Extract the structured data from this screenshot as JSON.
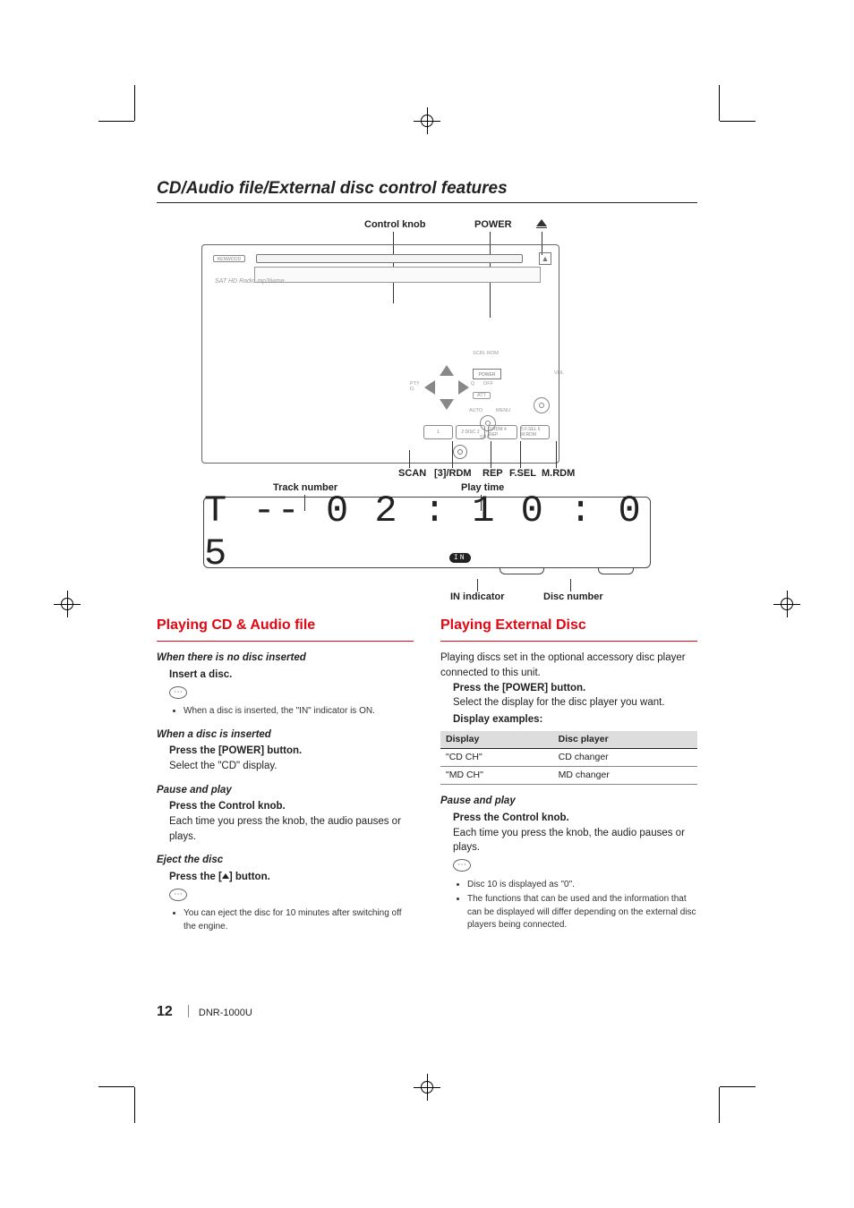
{
  "page_title": "CD/Audio file/External disc control features",
  "diagram_labels": {
    "control_knob": "Control knob",
    "power": "POWER",
    "scan": "SCAN",
    "btn3rdm": "[3]/RDM",
    "rep": "REP",
    "fsel": "F.SEL",
    "mrdm": "M.RDM",
    "track_number": "Track number",
    "play_time": "Play time",
    "in_indicator": "IN indicator",
    "disc_number": "Disc number"
  },
  "device": {
    "brand": "KENWOOD",
    "sub": "SAT  HD Radio  mp3/wma",
    "power_btn": "POWER",
    "att": "ATT",
    "off": "OFF",
    "auto": "AUTO",
    "menu": "MENU",
    "src": "SRC",
    "scrl_rom": "SCRL ROM",
    "vol": "VOL",
    "buttons": [
      "1",
      "2 DISC 2",
      "3 RDM  4 REP",
      "5 F.SEL  6 M.RDM"
    ],
    "q": "Q"
  },
  "lcd": {
    "text": "T -- 0 2 : 1 0 : 0 5",
    "in": "IN"
  },
  "left": {
    "heading": "Playing CD & Audio file",
    "s1_title": "When there is no disc inserted",
    "s1_instr": "Insert a disc.",
    "s1_note1": "When a disc is inserted, the \"IN\" indicator is ON.",
    "s2_title": "When a disc is inserted",
    "s2_instr": "Press the [POWER] button.",
    "s2_body": "Select the \"CD\" display.",
    "s3_title": "Pause and play",
    "s3_instr": "Press the Control knob.",
    "s3_body": "Each time you press the knob, the audio pauses or plays.",
    "s4_title": "Eject the disc",
    "s4_instr_pre": "Press the [",
    "s4_instr_post": "] button.",
    "s4_note1": "You can eject the disc for 10 minutes after switching off the engine."
  },
  "right": {
    "heading": "Playing External Disc",
    "intro": "Playing discs set in the optional accessory disc player connected to this unit.",
    "instr1": "Press the [POWER] button.",
    "body1": "Select the display for the disc player you want.",
    "body2": "Display examples:",
    "table": {
      "headers": [
        "Display",
        "Disc player"
      ],
      "rows": [
        [
          "\"CD CH\"",
          "CD changer"
        ],
        [
          "\"MD CH\"",
          "MD changer"
        ]
      ]
    },
    "s2_title": "Pause and play",
    "s2_instr": "Press the Control knob.",
    "s2_body": "Each time you press the knob, the audio pauses or plays.",
    "note1": "Disc 10 is displayed as \"0\".",
    "note2": "The functions that can be used and the information that can be displayed will differ depending on the external disc players being connected."
  },
  "footer": {
    "page": "12",
    "model": "DNR-1000U"
  }
}
